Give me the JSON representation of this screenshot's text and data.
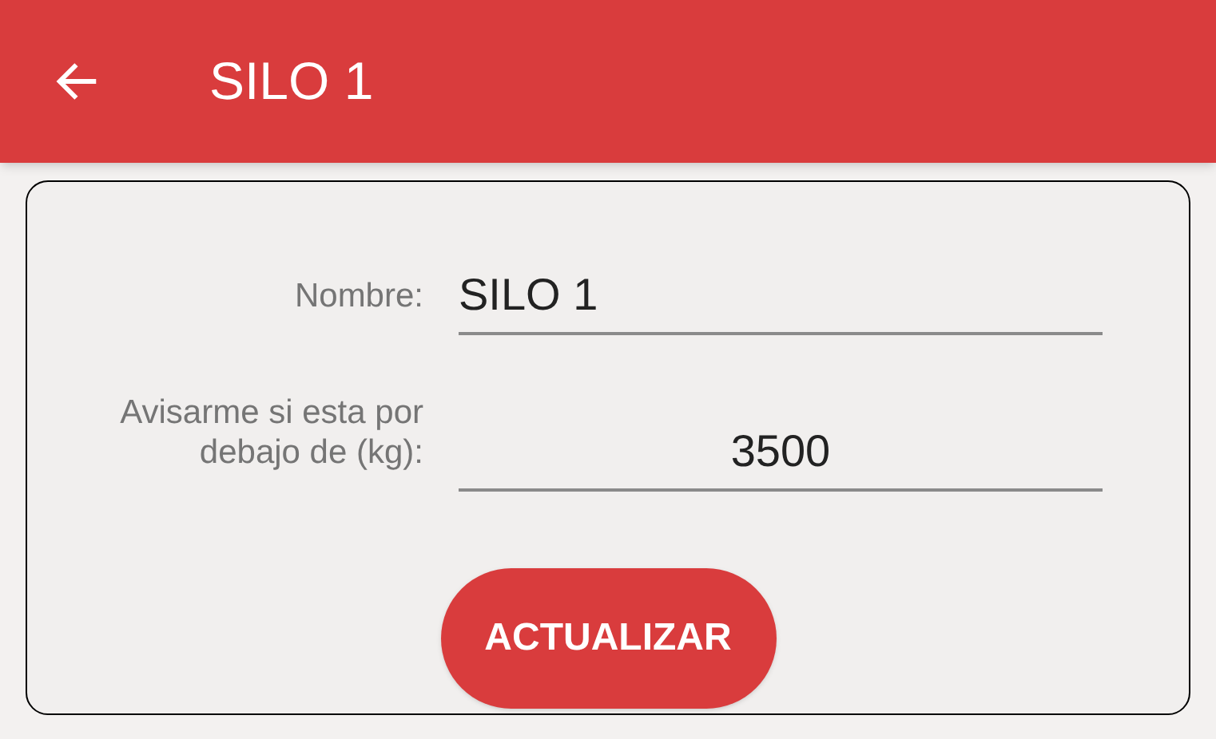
{
  "header": {
    "title": "SILO 1"
  },
  "form": {
    "fields": [
      {
        "label": "Nombre:",
        "value": "SILO 1",
        "kind": "text"
      },
      {
        "label": "Avisarme si esta por debajo de (kg):",
        "value": "3500",
        "kind": "number"
      }
    ],
    "button": "ACTUALIZAR"
  }
}
